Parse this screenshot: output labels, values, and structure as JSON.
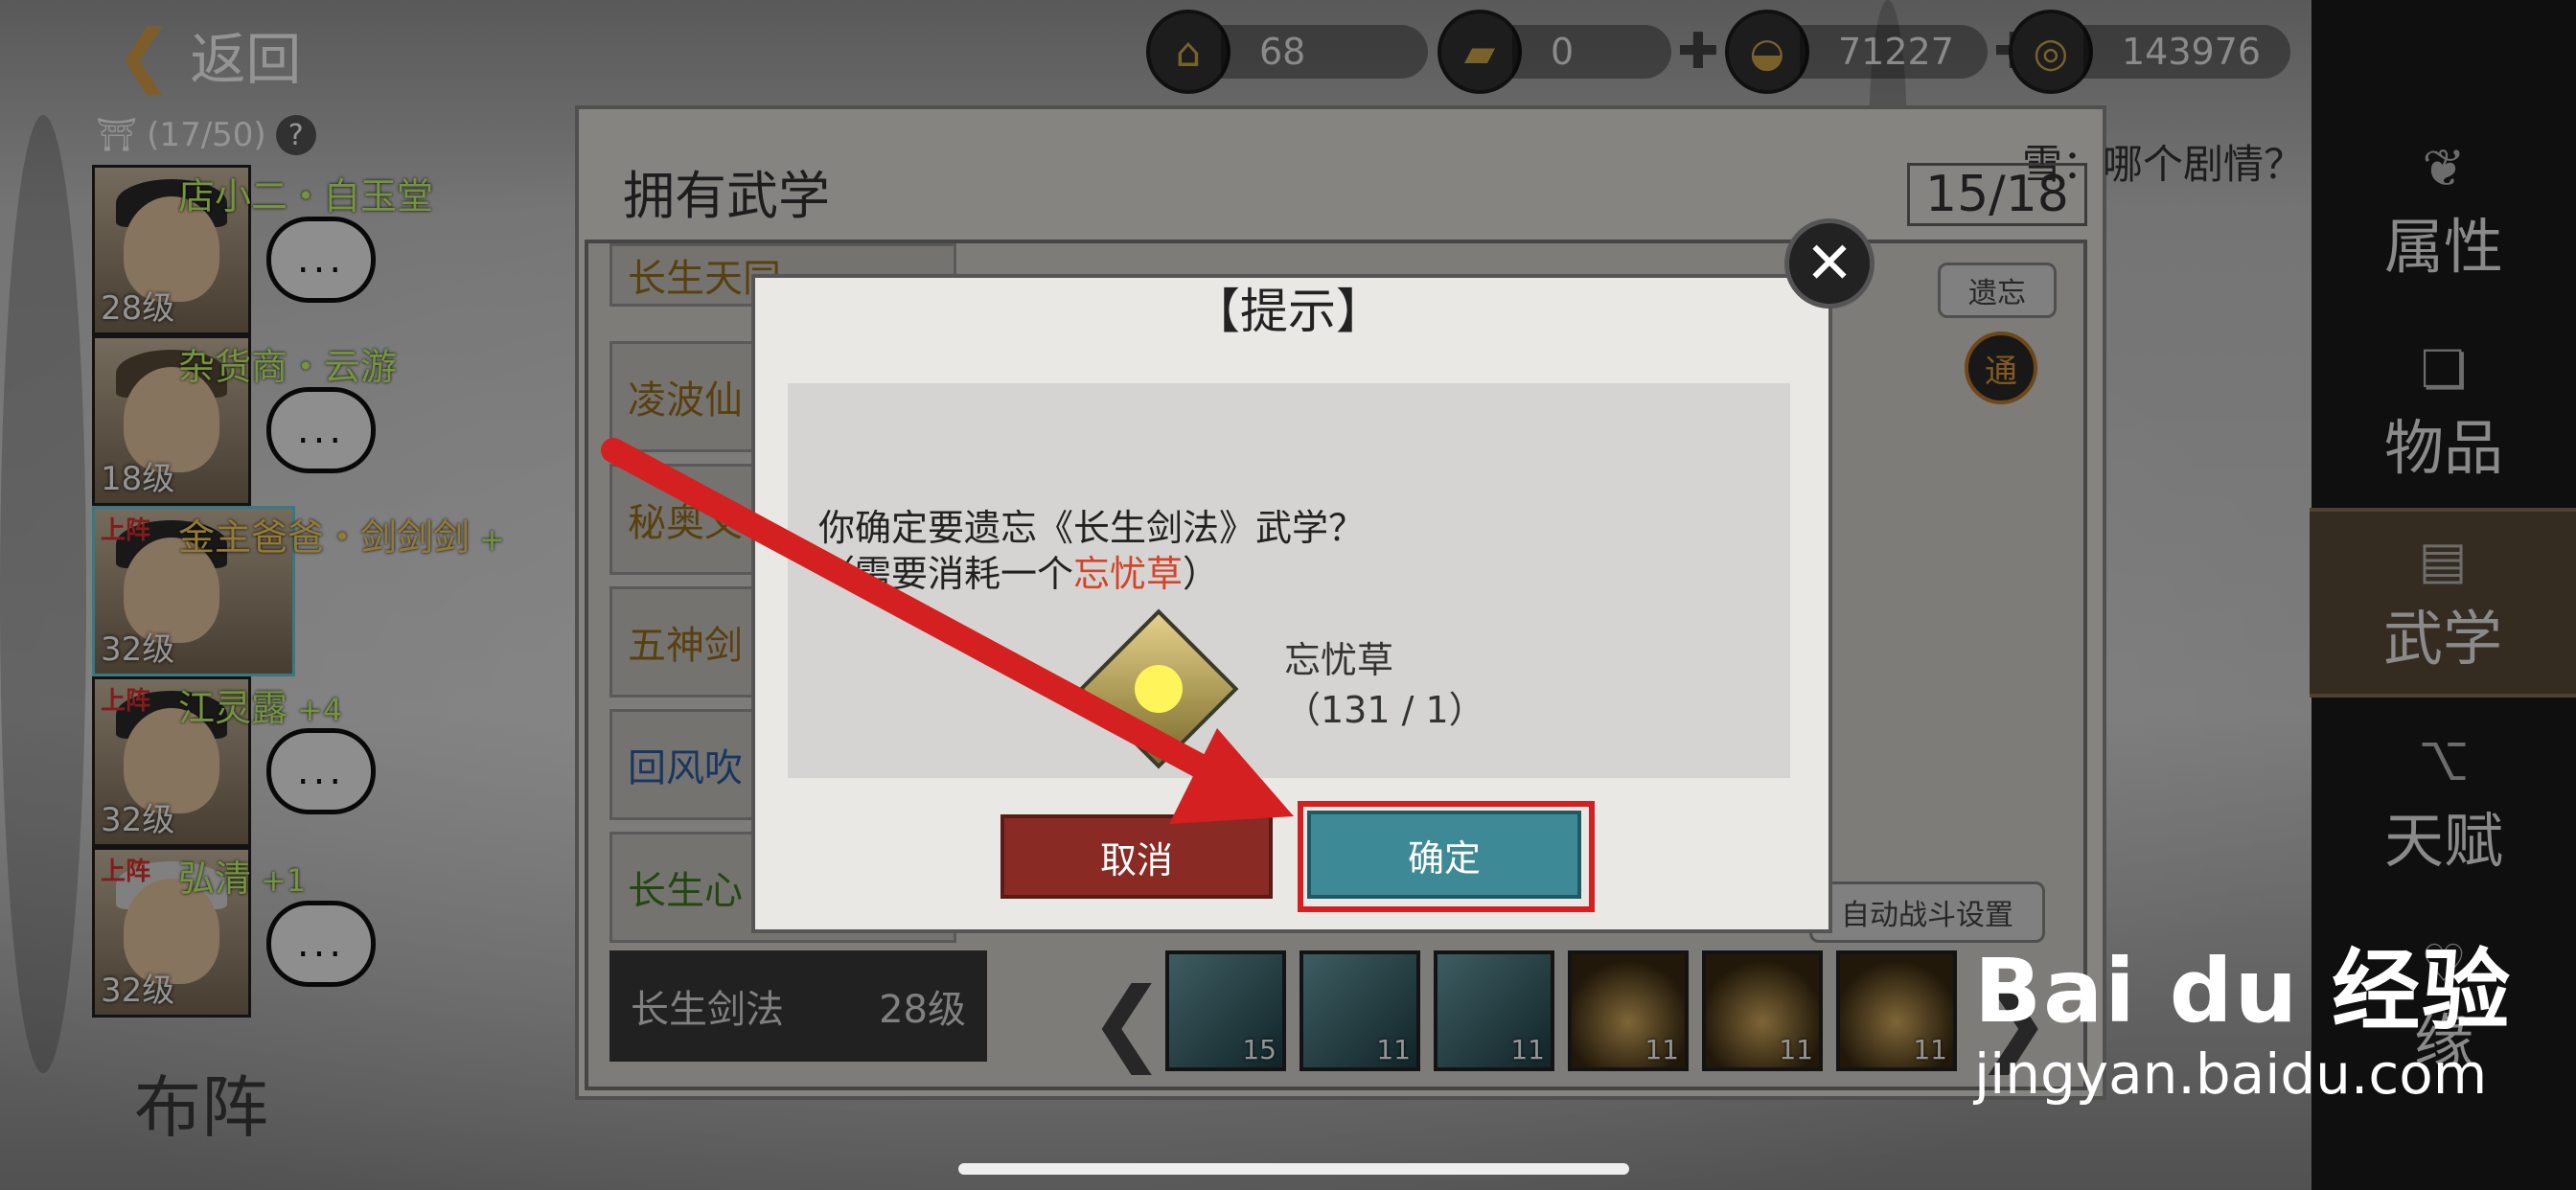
{
  "top": {
    "back_label": "返回",
    "resources": [
      {
        "icon": "stamina-icon",
        "value": "68",
        "plus": false
      },
      {
        "icon": "gold-bar-icon",
        "value": "0",
        "plus": true
      },
      {
        "icon": "silver-ingot-icon",
        "value": "71227",
        "plus": true
      },
      {
        "icon": "coin-icon",
        "value": "143976",
        "plus": false
      }
    ]
  },
  "roster": {
    "count": "(17/50)",
    "help": "?",
    "heroes": [
      {
        "name": "店小二・白玉堂",
        "level": "28级",
        "on_team": "",
        "plus": "",
        "chat": "..."
      },
      {
        "name": "杂货商・云游",
        "level": "18级",
        "on_team": "",
        "plus": "",
        "chat": "..."
      },
      {
        "name": "金主爸爸・剑剑剑",
        "level": "32级",
        "on_team": "上阵",
        "plus": "+",
        "chat": ""
      },
      {
        "name": "江灵露",
        "level": "32级",
        "on_team": "上阵",
        "plus": "+4",
        "chat": "..."
      },
      {
        "name": "弘清",
        "level": "32级",
        "on_team": "上阵",
        "plus": "+1",
        "chat": "..."
      }
    ],
    "formation": "布阵"
  },
  "panel": {
    "title": "拥有武学",
    "count": "15/18",
    "dialogue": "雪：哪个剧情？",
    "forget": "遗忘",
    "tong": "通",
    "skills": [
      "长生天同",
      "凌波仙",
      "秘奥义",
      "五神剑",
      "回风吹",
      "长生心"
    ],
    "selected_name": "长生剑法",
    "selected_level": "28级",
    "auto_battle": "自动战斗设置",
    "slots": [
      "15",
      "11",
      "11",
      "11",
      "11",
      "11"
    ]
  },
  "tabs": [
    "属性",
    "物品",
    "武学",
    "天赋",
    "缘"
  ],
  "modal": {
    "title": "【提示】",
    "question": "你确定要遗忘《长生剑法》武学？",
    "cost_prefix": "（需要消耗一个",
    "cost_item": "忘忧草",
    "cost_suffix": "）",
    "item_name": "忘忧草",
    "item_count": "（131 / 1）",
    "cancel": "取消",
    "confirm": "确定"
  },
  "watermark": {
    "logo": "Bai du 经验",
    "url": "jingyan.baidu.com"
  }
}
